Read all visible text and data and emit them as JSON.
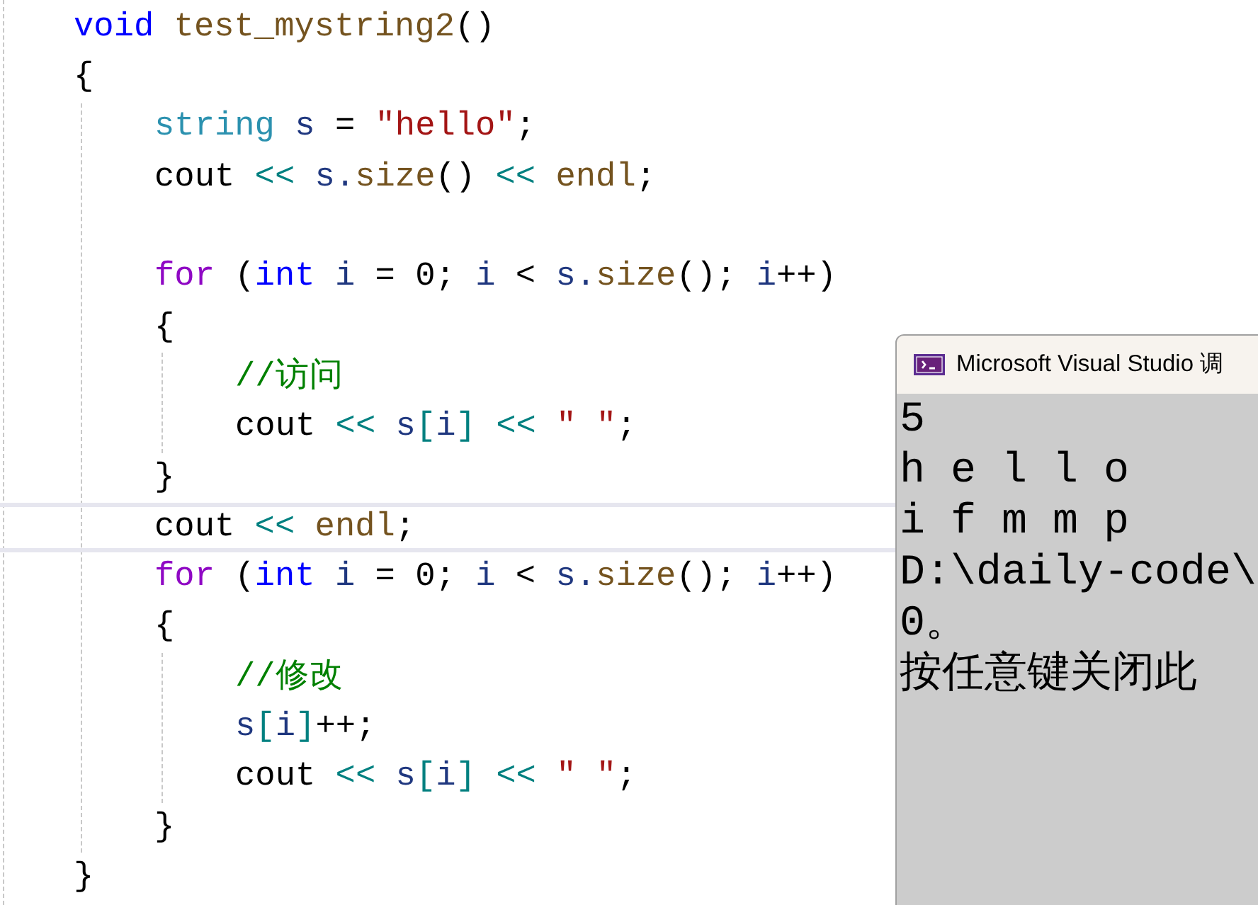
{
  "editor": {
    "lines": [
      {
        "current": false,
        "tokens": [
          {
            "text": "void",
            "kind": "keyword"
          },
          {
            "text": " test_mystring2",
            "kind": "function"
          },
          {
            "text": "()",
            "kind": "plain"
          }
        ]
      },
      {
        "current": false,
        "tokens": [
          {
            "text": "{",
            "kind": "plain"
          }
        ],
        "children": [
          {
            "current": false,
            "tokens": [
              {
                "text": "string",
                "kind": "type"
              },
              {
                "text": " s",
                "kind": "variable"
              },
              {
                "text": " = ",
                "kind": "plain"
              },
              {
                "text": "″hello″",
                "kind": "string"
              },
              {
                "text": ";",
                "kind": "plain"
              }
            ]
          },
          {
            "current": false,
            "tokens": [
              {
                "text": "cout ",
                "kind": "plain"
              },
              {
                "text": "<<",
                "kind": "operator"
              },
              {
                "text": " s.",
                "kind": "variable"
              },
              {
                "text": "size",
                "kind": "function"
              },
              {
                "text": "() ",
                "kind": "plain"
              },
              {
                "text": "<<",
                "kind": "operator"
              },
              {
                "text": " endl",
                "kind": "function"
              },
              {
                "text": ";",
                "kind": "plain"
              }
            ]
          },
          {
            "current": false
          },
          {
            "current": false,
            "tokens": [
              {
                "text": "for",
                "kind": "control"
              },
              {
                "text": " (",
                "kind": "plain"
              },
              {
                "text": "int",
                "kind": "keyword"
              },
              {
                "text": " i",
                "kind": "variable"
              },
              {
                "text": " = 0; ",
                "kind": "plain"
              },
              {
                "text": "i",
                "kind": "variable"
              },
              {
                "text": " < ",
                "kind": "plain"
              },
              {
                "text": "s.",
                "kind": "variable"
              },
              {
                "text": "size",
                "kind": "function"
              },
              {
                "text": "(); ",
                "kind": "plain"
              },
              {
                "text": "i",
                "kind": "variable"
              },
              {
                "text": "++)",
                "kind": "plain"
              }
            ]
          },
          {
            "current": false,
            "tokens": [
              {
                "text": "{",
                "kind": "plain"
              }
            ],
            "children": [
              {
                "current": false,
                "tokens": [
                  {
                    "text": "//访问",
                    "kind": "comment"
                  }
                ]
              },
              {
                "current": false,
                "tokens": [
                  {
                    "text": "cout ",
                    "kind": "plain"
                  },
                  {
                    "text": "<<",
                    "kind": "operator"
                  },
                  {
                    "text": " s",
                    "kind": "variable"
                  },
                  {
                    "text": "[",
                    "kind": "operator"
                  },
                  {
                    "text": "i",
                    "kind": "variable"
                  },
                  {
                    "text": "]",
                    "kind": "operator"
                  },
                  {
                    "text": " <<",
                    "kind": "operator"
                  },
                  {
                    "text": " ″ ″",
                    "kind": "string"
                  },
                  {
                    "text": ";",
                    "kind": "plain"
                  }
                ]
              }
            ]
          },
          {
            "current": false,
            "tokens": [
              {
                "text": "}",
                "kind": "plain"
              }
            ]
          },
          {
            "current": true,
            "tokens": [
              {
                "text": "cout ",
                "kind": "plain"
              },
              {
                "text": "<<",
                "kind": "operator"
              },
              {
                "text": " endl",
                "kind": "function"
              },
              {
                "text": ";",
                "kind": "plain"
              }
            ]
          },
          {
            "current": false,
            "tokens": [
              {
                "text": "for",
                "kind": "control"
              },
              {
                "text": " (",
                "kind": "plain"
              },
              {
                "text": "int",
                "kind": "keyword"
              },
              {
                "text": " i",
                "kind": "variable"
              },
              {
                "text": " = 0; ",
                "kind": "plain"
              },
              {
                "text": "i",
                "kind": "variable"
              },
              {
                "text": " < ",
                "kind": "plain"
              },
              {
                "text": "s.",
                "kind": "variable"
              },
              {
                "text": "size",
                "kind": "function"
              },
              {
                "text": "(); ",
                "kind": "plain"
              },
              {
                "text": "i",
                "kind": "variable"
              },
              {
                "text": "++)",
                "kind": "plain"
              }
            ]
          },
          {
            "current": false,
            "tokens": [
              {
                "text": "{",
                "kind": "plain"
              }
            ],
            "children": [
              {
                "current": false,
                "tokens": [
                  {
                    "text": "//修改",
                    "kind": "comment"
                  }
                ]
              },
              {
                "current": false,
                "tokens": [
                  {
                    "text": "s",
                    "kind": "variable"
                  },
                  {
                    "text": "[",
                    "kind": "operator"
                  },
                  {
                    "text": "i",
                    "kind": "variable"
                  },
                  {
                    "text": "]",
                    "kind": "operator"
                  },
                  {
                    "text": "++;",
                    "kind": "plain"
                  }
                ]
              },
              {
                "current": false,
                "tokens": [
                  {
                    "text": "cout ",
                    "kind": "plain"
                  },
                  {
                    "text": "<<",
                    "kind": "operator"
                  },
                  {
                    "text": " s",
                    "kind": "variable"
                  },
                  {
                    "text": "[",
                    "kind": "operator"
                  },
                  {
                    "text": "i",
                    "kind": "variable"
                  },
                  {
                    "text": "]",
                    "kind": "operator"
                  },
                  {
                    "text": " <<",
                    "kind": "operator"
                  },
                  {
                    "text": " ″ ″",
                    "kind": "string"
                  },
                  {
                    "text": ";",
                    "kind": "plain"
                  }
                ]
              }
            ]
          },
          {
            "current": false,
            "tokens": [
              {
                "text": "}",
                "kind": "plain"
              }
            ]
          }
        ]
      },
      {
        "current": false,
        "tokens": [
          {
            "text": "}",
            "kind": "plain"
          }
        ]
      }
    ]
  },
  "console": {
    "title": "Microsoft Visual Studio 调",
    "lines": [
      "5",
      "h e l l o",
      "i f m m p",
      "D:\\daily-code\\",
      "0。",
      "按任意键关闭此"
    ]
  }
}
